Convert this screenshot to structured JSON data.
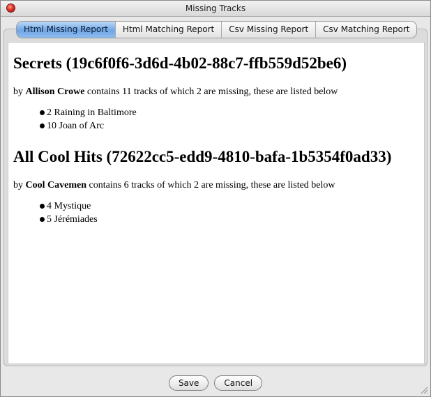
{
  "window": {
    "title": "Missing Tracks"
  },
  "tabs": [
    {
      "label": "Html Missing Report",
      "selected": true
    },
    {
      "label": "Html Matching Report",
      "selected": false
    },
    {
      "label": "Csv Missing Report",
      "selected": false
    },
    {
      "label": "Csv Matching Report",
      "selected": false
    }
  ],
  "report": {
    "playlists": [
      {
        "heading": "Secrets (19c6f0f6-3d6d-4b02-88c7-ffb559d52be6)",
        "by_prefix": "by",
        "artist": "Allison Crowe",
        "summary": "contains 11 tracks of which 2 are missing, these are listed below",
        "tracks": [
          "2 Raining in Baltimore",
          "10 Joan of Arc"
        ]
      },
      {
        "heading": "All Cool Hits (72622cc5-edd9-4810-bafa-1b5354f0ad33)",
        "by_prefix": "by",
        "artist": "Cool Cavemen",
        "summary": "contains 6 tracks of which 2 are missing, these are listed below",
        "tracks": [
          "4 Mystique",
          "5 Jérémiades"
        ]
      }
    ]
  },
  "buttons": {
    "save_label": "Save",
    "cancel_label": "Cancel"
  },
  "colors": {
    "selected_tab": "#6fa6e5",
    "close_button": "#e0342a",
    "content_background": "#ffffff"
  },
  "icons": {
    "close": "close-icon",
    "resize": "resize-grip-icon",
    "bullet": "bullet-icon"
  }
}
